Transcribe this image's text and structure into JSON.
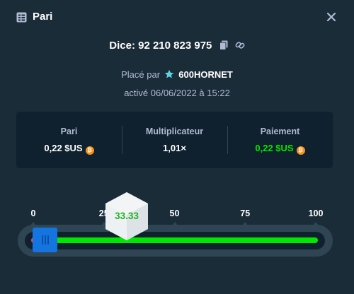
{
  "header": {
    "title": "Pari",
    "icon": "bet-slip-icon"
  },
  "bet": {
    "dice_label": "Dice: 92 210 823 975",
    "placed_by_prefix": "Placé par",
    "username": "600HORNET",
    "activated": "activé 06/06/2022 à 15:22"
  },
  "stats": [
    {
      "label": "Pari",
      "value": "0,22 $US",
      "currency_icon": "bitcoin-icon"
    },
    {
      "label": "Multiplicateur",
      "value": "1,01×"
    },
    {
      "label": "Paiement",
      "value": "0,22 $US",
      "currency_icon": "bitcoin-icon"
    }
  ],
  "slider": {
    "ticks": [
      "0",
      "25",
      "50",
      "75",
      "100"
    ],
    "roll_result": "33.33",
    "threshold": 1.98
  },
  "colors": {
    "background": "#1a2c38",
    "panel": "#0f212e",
    "win_green": "#00e701",
    "lose_red": "#ed4163",
    "handle_blue": "#1475e1",
    "bitcoin_orange": "#f7931a"
  }
}
